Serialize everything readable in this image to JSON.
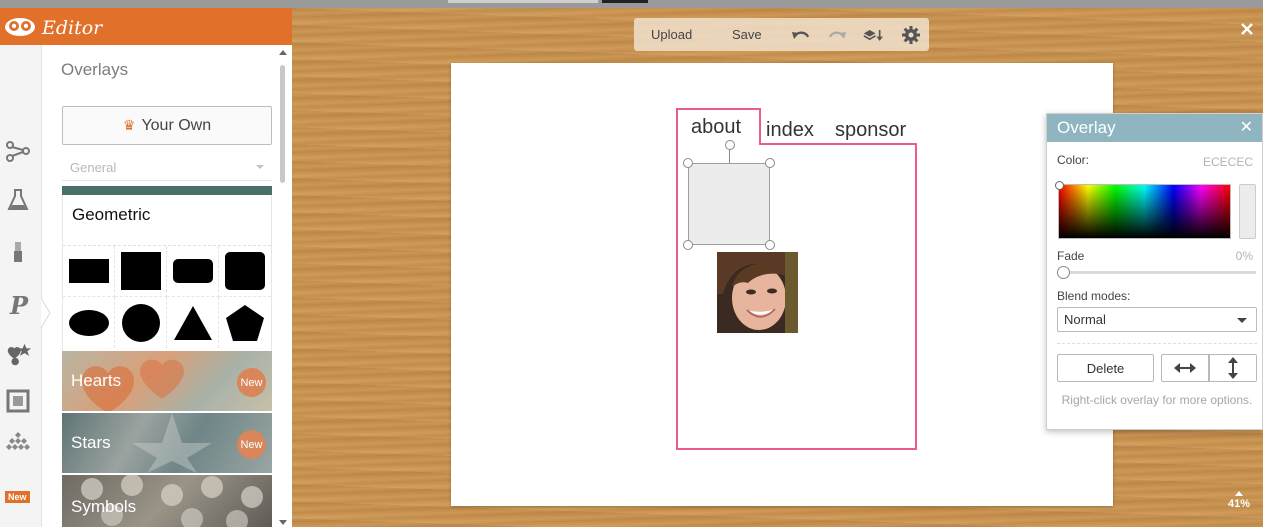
{
  "app": {
    "title": "Editor"
  },
  "sidebar": {
    "panel_title": "Overlays",
    "your_own_label": "Your Own",
    "category_label": "General",
    "new_badge": "New",
    "geometric_title": "Geometric",
    "packs": [
      {
        "label": "Hearts",
        "badge": "New"
      },
      {
        "label": "Stars",
        "badge": "New"
      },
      {
        "label": "Symbols",
        "badge": ""
      }
    ]
  },
  "toolbar": {
    "upload_label": "Upload",
    "save_label": "Save"
  },
  "canvas": {
    "nav": {
      "about": "about",
      "index": "index",
      "sponsor": "sponsor"
    }
  },
  "zoom": {
    "level": "41%"
  },
  "overlay_panel": {
    "title": "Overlay",
    "color_label": "Color:",
    "color_value": "ECECEC",
    "fade_label": "Fade",
    "fade_value": "0%",
    "blend_label": "Blend modes:",
    "blend_value": "Normal",
    "delete_label": "Delete",
    "hint": "Right-click overlay for more options."
  },
  "colors": {
    "brand": "#e0702a",
    "overlay_header": "#8fb5c1",
    "frame_pink": "#ea5a93",
    "overlay_fill": "#ececec"
  }
}
